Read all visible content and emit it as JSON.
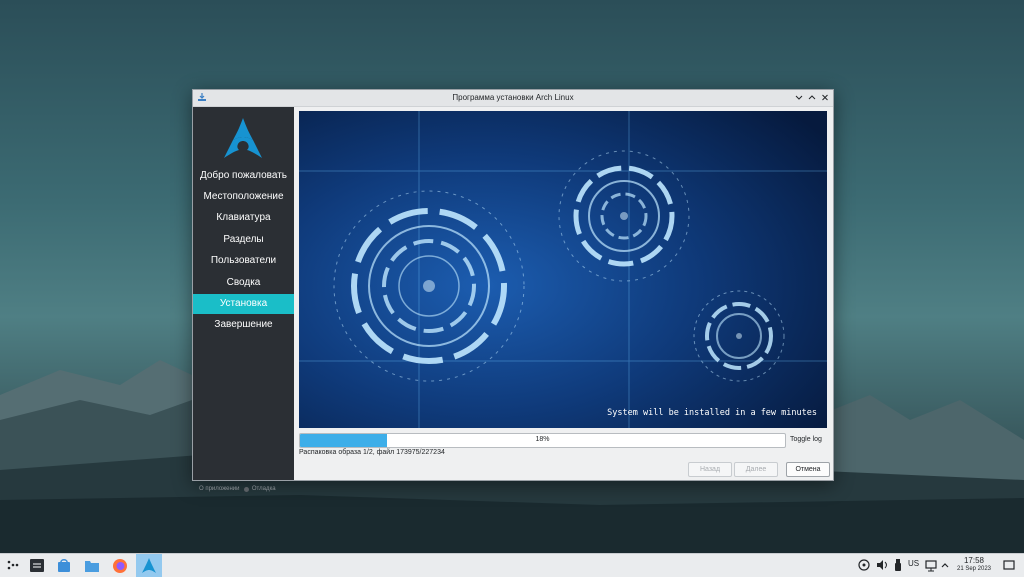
{
  "window": {
    "title": "Программа установки Arch Linux"
  },
  "sidebar": {
    "items": [
      {
        "label": "Добро пожаловать",
        "active": false
      },
      {
        "label": "Местоположение",
        "active": false
      },
      {
        "label": "Клавиатура",
        "active": false
      },
      {
        "label": "Разделы",
        "active": false
      },
      {
        "label": "Пользователи",
        "active": false
      },
      {
        "label": "Сводка",
        "active": false
      },
      {
        "label": "Установка",
        "active": true
      },
      {
        "label": "Завершение",
        "active": false
      }
    ],
    "footer": {
      "about": "О приложении",
      "debug": "Отладка"
    }
  },
  "slideshow": {
    "caption": "System will be installed in a few minutes"
  },
  "progress": {
    "value": 0.18,
    "label": "18%",
    "toggle_log": "Toggle log",
    "status": "Распаковка образа 1/2, файл 173975/227234"
  },
  "buttons": {
    "back": "Назад",
    "next": "Далее",
    "cancel": "Отмена"
  },
  "taskbar": {
    "keyboard_layout": "US",
    "time": "17:58",
    "date": "21 Sep 2023"
  },
  "colors": {
    "accent": "#1abec8",
    "progress": "#3daee9",
    "sidebar_bg": "#2b2f34"
  }
}
